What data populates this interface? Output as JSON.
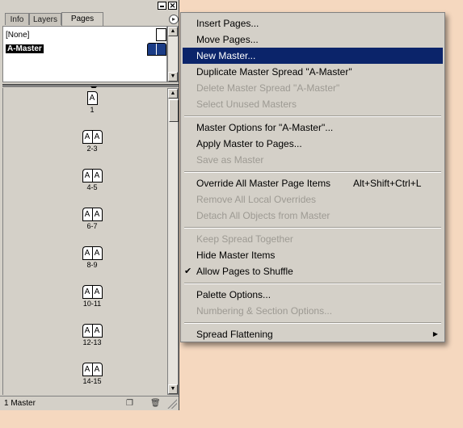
{
  "palette": {
    "tabs": [
      "Info",
      "Layers",
      "Pages"
    ],
    "masters": {
      "none_label": "[None]",
      "a_master_label": "A-Master"
    },
    "spreads": [
      {
        "label": "1",
        "pages": [
          "A"
        ]
      },
      {
        "label": "2-3",
        "pages": [
          "A",
          "A"
        ]
      },
      {
        "label": "4-5",
        "pages": [
          "A",
          "A"
        ]
      },
      {
        "label": "6-7",
        "pages": [
          "A",
          "A"
        ]
      },
      {
        "label": "8-9",
        "pages": [
          "A",
          "A"
        ]
      },
      {
        "label": "10-11",
        "pages": [
          "A",
          "A"
        ]
      },
      {
        "label": "12-13",
        "pages": [
          "A",
          "A"
        ]
      },
      {
        "label": "14-15",
        "pages": [
          "A",
          "A"
        ]
      }
    ],
    "status": "1 Master",
    "close_glyph": "✕"
  },
  "menu": {
    "items": [
      {
        "label": "Insert Pages...",
        "state": "enabled"
      },
      {
        "label": "Move Pages...",
        "state": "enabled"
      },
      {
        "label": "New Master...",
        "state": "highlighted"
      },
      {
        "label": "Duplicate Master Spread \"A-Master\"",
        "state": "enabled"
      },
      {
        "label": "Delete Master Spread \"A-Master\"",
        "state": "disabled"
      },
      {
        "label": "Select Unused Masters",
        "state": "disabled"
      },
      {
        "label": "Master Options for \"A-Master\"...",
        "state": "enabled"
      },
      {
        "label": "Apply Master to Pages...",
        "state": "enabled"
      },
      {
        "label": "Save as Master",
        "state": "disabled"
      },
      {
        "label": "Override All Master Page Items",
        "state": "enabled",
        "shortcut": "Alt+Shift+Ctrl+L"
      },
      {
        "label": "Remove All Local Overrides",
        "state": "disabled"
      },
      {
        "label": "Detach All Objects from Master",
        "state": "disabled"
      },
      {
        "label": "Keep Spread Together",
        "state": "disabled"
      },
      {
        "label": "Hide Master Items",
        "state": "enabled"
      },
      {
        "label": "Allow Pages to Shuffle",
        "state": "enabled",
        "checked": true
      },
      {
        "label": "Palette Options...",
        "state": "enabled"
      },
      {
        "label": "Numbering & Section Options...",
        "state": "disabled"
      },
      {
        "label": "Spread Flattening",
        "state": "enabled",
        "submenu": true
      }
    ]
  },
  "colors": {
    "highlight": "#0b246a",
    "master_thumb": "#1b3c86",
    "background": "#f5d8bf"
  }
}
